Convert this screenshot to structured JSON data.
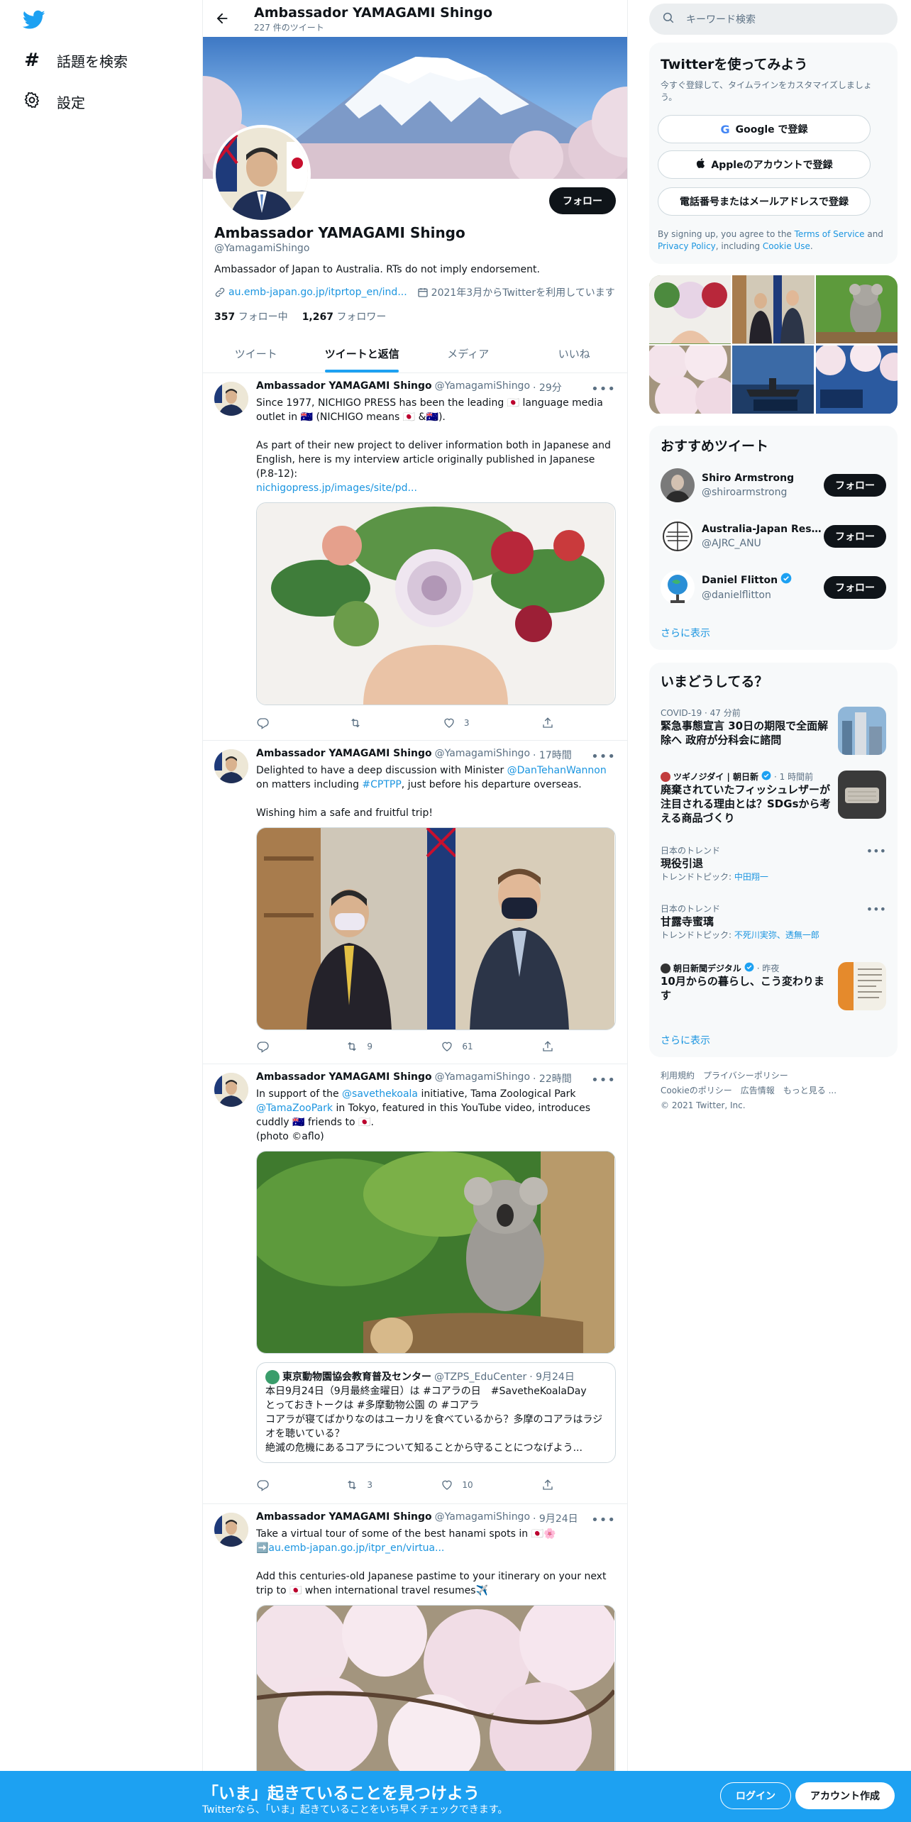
{
  "nav": {
    "items": [
      {
        "label": "話題を検索",
        "icon": "hashtag-icon"
      },
      {
        "label": "設定",
        "icon": "gear-icon"
      }
    ]
  },
  "header": {
    "name": "Ambassador YAMAGAMI Shingo",
    "tweet_count": "227 件のツイート"
  },
  "profile": {
    "name": "Ambassador YAMAGAMI Shingo",
    "handle": "@YamagamiShingo",
    "bio": "Ambassador of Japan to Australia. RTs do not imply endorsement.",
    "link": "au.emb-japan.go.jp/itprtop_en/ind...",
    "joined": "2021年3月からTwitterを利用しています",
    "following_count": "357",
    "following_label": "フォロー中",
    "followers_count": "1,267",
    "followers_label": "フォロワー",
    "follow_label": "フォロー"
  },
  "tabs": [
    {
      "label": "ツイート",
      "active": false
    },
    {
      "label": "ツイートと返信",
      "active": true
    },
    {
      "label": "メディア",
      "active": false
    },
    {
      "label": "いいね",
      "active": false
    }
  ],
  "tweets": [
    {
      "name": "Ambassador YAMAGAMI Shingo",
      "handle": "@YamagamiShingo",
      "time": "· 29分",
      "line1": "Since 1977, NICHIGO PRESS has been the leading 🇯🇵 language media outlet in 🇦🇺 (NICHIGO means 🇯🇵 &🇦🇺).",
      "line2": "As part of their new project to deliver information both in Japanese and English, here is my interview article originally published in Japanese (P.8-12):",
      "link": "nichigopress.jp/images/site/pd...",
      "replies": "",
      "retweets": "",
      "likes": "3"
    },
    {
      "name": "Ambassador YAMAGAMI Shingo",
      "handle": "@YamagamiShingo",
      "time": "· 17時間",
      "text_a": "Delighted to have a deep discussion with Minister ",
      "mention": "@DanTehanWannon",
      "text_b": " on matters including ",
      "hashtag": "#CPTPP",
      "text_c": ", just before his departure overseas.",
      "line2": "Wishing him a safe and fruitful trip!",
      "replies": "",
      "retweets": "9",
      "likes": "61"
    },
    {
      "name": "Ambassador YAMAGAMI Shingo",
      "handle": "@YamagamiShingo",
      "time": "· 22時間",
      "text_a": "In support of the ",
      "mention1": "@savethekoala",
      "text_b": " initiative, Tama Zoological Park ",
      "mention2": "@TamaZooPark",
      "text_c": " in Tokyo, featured in this YouTube video, introduces cuddly 🇦🇺 friends to 🇯🇵.",
      "line2": "(photo ©aflo)",
      "quote": {
        "name": "東京動物園協会教育普及センター",
        "handle": "@TZPS_EduCenter",
        "time": "· 9月24日",
        "lines": [
          "本日9月24日（9月最終金曜日）は #コアラの日　#SavetheKoalaDay",
          "とっておきトークは #多摩動物公園 の #コアラ",
          "コアラが寝てばかりなのはユーカリを食べているから？多摩のコアラはラジオを聴いている？",
          "絶滅の危機にあるコアラについて知ることから守ることにつなげよう..."
        ]
      },
      "replies": "",
      "retweets": "3",
      "likes": "10"
    },
    {
      "name": "Ambassador YAMAGAMI Shingo",
      "handle": "@YamagamiShingo",
      "time": "· 9月24日",
      "line1": "Take a virtual tour of some of the best hanami spots in 🇯🇵🌸",
      "link": "➡️au.emb-japan.go.jp/itpr_en/virtua...",
      "line2": "Add this centuries-old Japanese pastime to your itinerary on your next trip to 🇯🇵 when international travel resumes✈️"
    }
  ],
  "search": {
    "placeholder": "キーワード検索"
  },
  "signup_card": {
    "title": "Twitterを使ってみよう",
    "subtitle": "今すぐ登録して、タイムラインをカスタマイズしましょう。",
    "google": "Google で登録",
    "apple": "Appleのアカウントで登録",
    "phone": "電話番号またはメールアドレスで登録",
    "legal_a": "By signing up, you agree to the ",
    "tos": "Terms of Service",
    "legal_b": " and ",
    "privacy": "Privacy Policy",
    "legal_c": ", including ",
    "cookie": "Cookie Use",
    "legal_d": "."
  },
  "recommend": {
    "title": "おすすめツイート",
    "accounts": [
      {
        "name": "Shiro Armstrong",
        "handle": "@shiroarmstrong",
        "verified": false
      },
      {
        "name": "Australia-Japan Resear",
        "handle": "@AJRC_ANU",
        "verified": false
      },
      {
        "name": "Daniel Flitton",
        "handle": "@danielflitton",
        "verified": true
      }
    ],
    "follow": "フォロー",
    "more": "さらに表示"
  },
  "trends": {
    "title": "いまどうしてる？",
    "items": [
      {
        "meta": "COVID-19 · 47 分前",
        "title": "緊急事態宣言 30日の期限で全面解除へ 政府が分科会に諮問"
      },
      {
        "source": "ツギノジダイ | 朝日新",
        "time": "· 1 時間前",
        "title": "廃棄されていたフィッシュレザーが注目される理由とは？SDGsから考える商品づくり"
      },
      {
        "meta": "日本のトレンド",
        "title": "現役引退",
        "topic_label": "トレンドトピック: ",
        "topic": "中田翔一"
      },
      {
        "meta": "日本のトレンド",
        "title": "甘露寺蜜璃",
        "topic_label": "トレンドトピック: ",
        "topic": "不死川実弥、透無一郎"
      },
      {
        "source": "朝日新聞デジタル",
        "time": "· 昨夜",
        "title": "10月からの暮らし、こう変わります"
      }
    ],
    "more": "さらに表示"
  },
  "footer": {
    "row1": [
      "利用規約",
      "プライバシーポリシー"
    ],
    "row2": [
      "Cookieのポリシー",
      "広告情報",
      "もっと見る ..."
    ],
    "copyright": "© 2021 Twitter, Inc."
  },
  "bottom_bar": {
    "title": "「いま」起きていることを見つけよう",
    "subtitle": "Twitterなら、「いま」起きていることをいち早くチェックできます。",
    "login": "ログイン",
    "signup": "アカウント作成"
  },
  "colors": {
    "accent": "#1da1f2",
    "link": "#1b95e0",
    "text": "#0f1419",
    "muted": "#5b7083"
  }
}
